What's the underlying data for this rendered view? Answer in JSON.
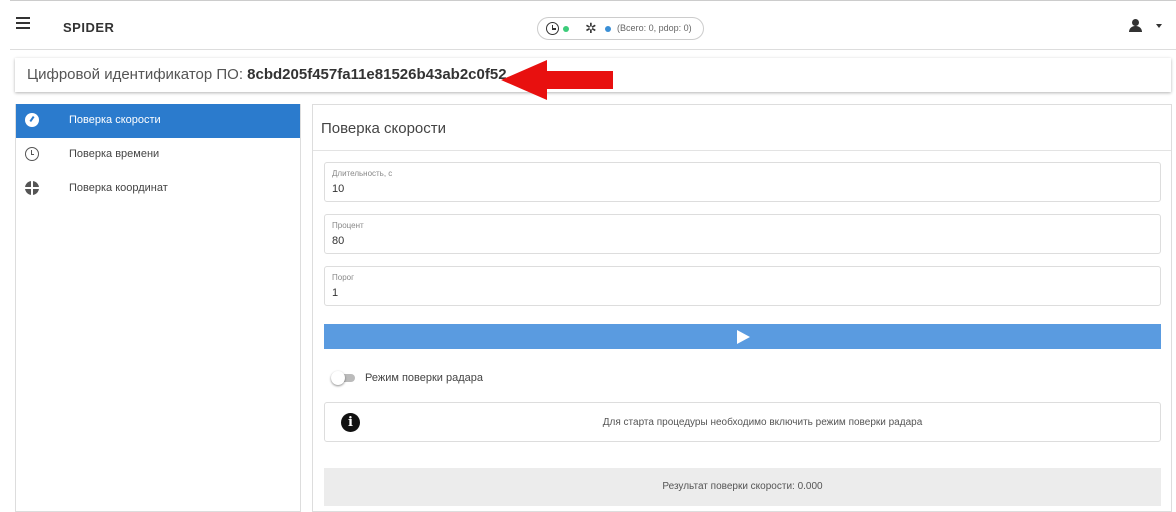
{
  "header": {
    "app_title": "SPIDER",
    "status_text": "(Всего: 0, pdop: 0)",
    "menu_icon": "hamburger-icon",
    "clock_icon": "clock-icon",
    "satellite_icon": "satellite-icon",
    "user_icon": "user-icon",
    "colors": {
      "clock_status": "#3ccc7a",
      "gnss_status": "#3a8fd6"
    }
  },
  "identifier": {
    "label": "Цифровой идентификатор ПО:",
    "value": "8cbd205f457fa11e81526b43ab2c0f52",
    "annotation_arrow_color": "#e8100f"
  },
  "sidebar": {
    "items": [
      {
        "label": "Поверка скорости",
        "icon": "speedometer-icon",
        "active": true
      },
      {
        "label": "Поверка времени",
        "icon": "clock-icon",
        "active": false
      },
      {
        "label": "Поверка координат",
        "icon": "globe-icon",
        "active": false
      }
    ],
    "accent_color": "#2b7bcd"
  },
  "main": {
    "title": "Поверка скорости",
    "fields": [
      {
        "label": "Длительность, с",
        "value": "10"
      },
      {
        "label": "Процент",
        "value": "80"
      },
      {
        "label": "Порог",
        "value": "1"
      }
    ],
    "run_button_icon": "play-icon",
    "run_button_color": "#5a9be0",
    "toggle": {
      "label": "Режим поверки радара",
      "checked": false
    },
    "info": {
      "icon": "info-icon",
      "text": "Для старта процедуры необходимо включить режим поверки радара"
    },
    "result": {
      "text": "Результат поверки скорости: 0.000"
    }
  }
}
